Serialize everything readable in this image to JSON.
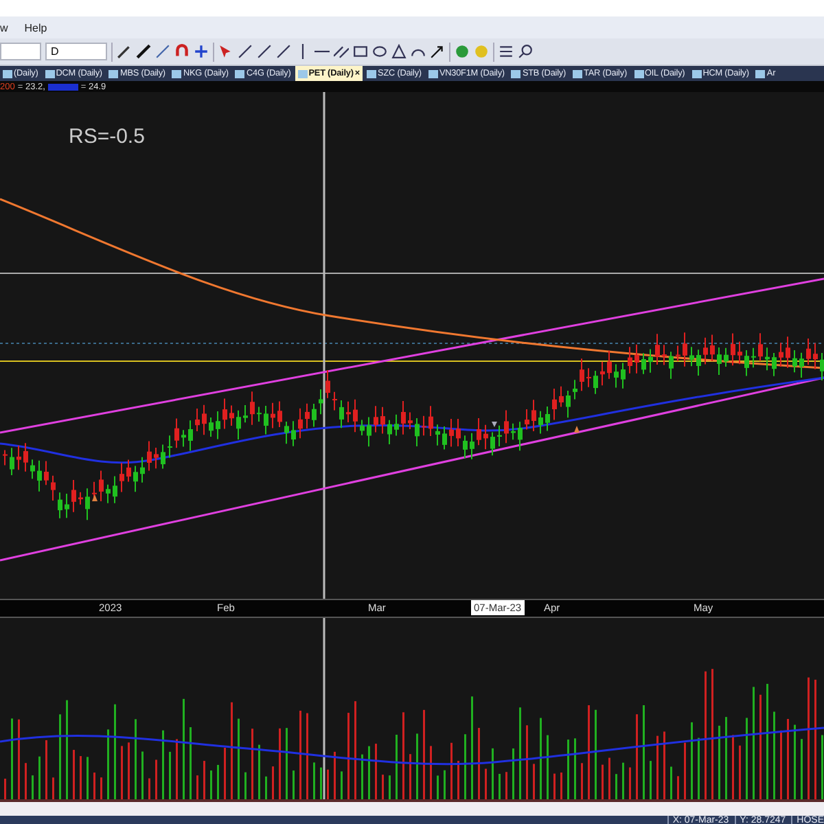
{
  "menu": [
    "w",
    "Help"
  ],
  "toolbar": {
    "combo_2": "D"
  },
  "close_icon": "×",
  "tabs": [
    {
      "label": "(Daily)",
      "selected": false
    },
    {
      "label": "DCM (Daily)",
      "selected": false
    },
    {
      "label": "MBS (Daily)",
      "selected": false
    },
    {
      "label": "NKG (Daily)",
      "selected": false
    },
    {
      "label": "C4G (Daily)",
      "selected": false
    },
    {
      "label": "PET (Daily)",
      "selected": true
    },
    {
      "label": "SZC (Daily)",
      "selected": false
    },
    {
      "label": "VN30F1M (Daily)",
      "selected": false
    },
    {
      "label": "STB (Daily)",
      "selected": false
    },
    {
      "label": "TAR (Daily)",
      "selected": false
    },
    {
      "label": "OIL (Daily)",
      "selected": false
    },
    {
      "label": "HCM (Daily)",
      "selected": false
    },
    {
      "label": "Ar",
      "selected": false
    }
  ],
  "legend": {
    "ma_label": "200",
    "ma_value": "= 23.2,",
    "second_value": "= 24.9"
  },
  "annotation": "RS=-0.5",
  "x_axis": [
    "2023",
    "Feb",
    "Mar",
    "Apr",
    "May"
  ],
  "crosshair_date": "07-Mar-23",
  "status_bar": [
    "X: 07-Mar-23",
    "Y: 28.7247",
    "HOSE"
  ]
}
